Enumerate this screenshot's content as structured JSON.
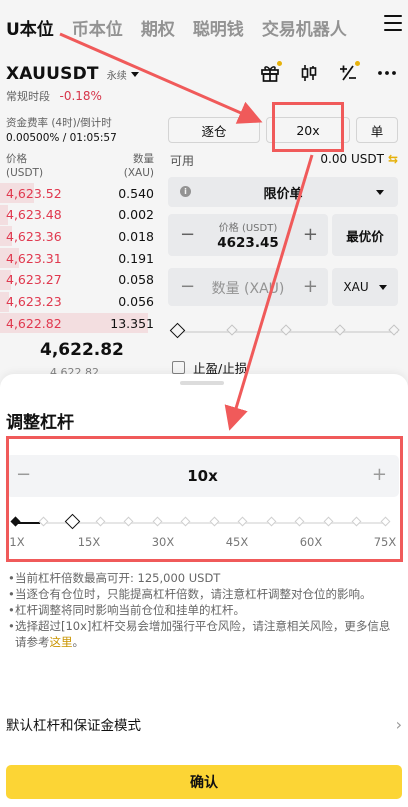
{
  "nav": {
    "tabs": [
      "U本位",
      "币本位",
      "期权",
      "聪明钱",
      "交易机器人"
    ]
  },
  "symbol": {
    "name": "XAUUSDT",
    "kind": "永续",
    "session": "常规时段",
    "change": "-0.18%"
  },
  "funding": {
    "label": "资金费率 (4时)/倒计时",
    "value": "0.00500% / 01:05:57"
  },
  "orderbook": {
    "price_header": "价格\n(USDT)",
    "qty_header": "数量\n(XAU)",
    "asks": [
      {
        "price": "4,623.52",
        "qty": "0.540",
        "depth": 0.22
      },
      {
        "price": "4,623.48",
        "qty": "0.002",
        "depth": 0.05
      },
      {
        "price": "4,623.36",
        "qty": "0.018",
        "depth": 0.08
      },
      {
        "price": "4,623.31",
        "qty": "0.191",
        "depth": 0.12
      },
      {
        "price": "4,623.27",
        "qty": "0.058",
        "depth": 0.07
      },
      {
        "price": "4,623.23",
        "qty": "0.056",
        "depth": 0.06
      },
      {
        "price": "4,622.82",
        "qty": "13.351",
        "depth": 0.95
      }
    ],
    "last_price": "4,622.82",
    "mark_price": "4,622.82"
  },
  "order_panel": {
    "margin_mode": "逐仓",
    "leverage": "20x",
    "position_mode": "单",
    "available_label": "可用",
    "available_value": "0.00 USDT",
    "order_type": "限价单",
    "price_label": "价格 (USDT)",
    "price_value": "4623.45",
    "best_price": "最优价",
    "qty_placeholder": "数量 (XAU)",
    "unit": "XAU",
    "tpsl": "止盈/止损"
  },
  "sheet": {
    "title": "调整杠杆",
    "leverage_value": "10x",
    "slider_fraction": 0.0678,
    "ticks": [
      "1X",
      "15X",
      "30X",
      "45X",
      "60X",
      "75X"
    ],
    "notes": [
      "当前杠杆倍数最高可开: 125,000 USDT",
      "当逐仓有仓位时，只能提高杠杆倍数，请注意杠杆调整对仓位的影响。",
      "杠杆调整将同时影响当前仓位和挂单的杠杆。"
    ],
    "note_last_text": "选择超过[10x]杠杆交易会增加强行平仓风险，请注意相关风险，更多信息请参考",
    "note_last_link": "这里",
    "note_last_end": "。",
    "default_row": "默认杠杆和保证金模式",
    "confirm": "确认"
  },
  "colors": {
    "brand": "#fcd535",
    "down": "#e0384e",
    "annotation": "#f05a5a"
  }
}
